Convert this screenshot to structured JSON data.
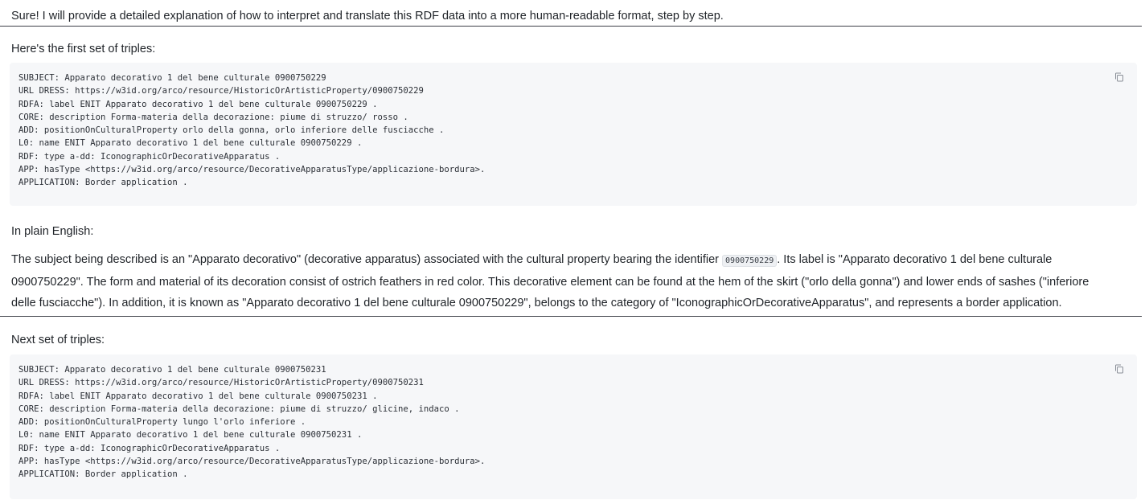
{
  "intro": "Sure! I will provide a detailed explanation of how to interpret and translate this RDF data into a more human-readable format, step by step.",
  "first_heading": "Here's the first set of triples:",
  "block1": {
    "lines": [
      "SUBJECT: Apparato decorativo 1 del bene culturale 0900750229",
      "URL DRESS: https://w3id.org/arco/resource/HistoricOrArtisticProperty/0900750229",
      "RDFA: label ENIT Apparato decorativo 1 del bene culturale 0900750229 .",
      "CORE: description Forma-materia della decorazione: piume di struzzo/ rosso .",
      "ADD: positionOnCulturalProperty orlo della gonna, orlo inferiore delle fusciacche .",
      "L0: name ENIT Apparato decorativo 1 del bene culturale 0900750229 .",
      "RDF: type a-dd: IconographicOrDecorativeApparatus .",
      "APP: hasType <https://w3id.org/arco/resource/DecorativeApparatusType/applicazione-bordura>.",
      "APPLICATION: Border application ."
    ]
  },
  "plain_heading": "In plain English:",
  "explanation": {
    "line1_a": "The subject being described is an \"Apparato decorativo\" (decorative apparatus) associated with the cultural property bearing the identifier ",
    "line1_code": "0900750229",
    "line1_b": ". Its label is \"Apparato decorativo 1 del bene culturale",
    "line2": "0900750229\". The form and material of its decoration consist of ostrich feathers in red color. This decorative element can be found at the hem of the skirt (\"orlo della gonna\") and lower ends of sashes (\"inferiore",
    "line3": "delle fusciacche\"). In addition, it is known as \"Apparato decorativo 1 del bene culturale 0900750229\", belongs to the category of \"IconographicOrDecorativeApparatus\", and represents a border application."
  },
  "next_heading": "Next set of triples:",
  "block2": {
    "lines": [
      "SUBJECT: Apparato decorativo 1 del bene culturale 0900750231",
      "URL DRESS: https://w3id.org/arco/resource/HistoricOrArtisticProperty/0900750231",
      "RDFA: label ENIT Apparato decorativo 1 del bene culturale 0900750231 .",
      "CORE: description Forma-materia della decorazione: piume di struzzo/ glicine, indaco .",
      "ADD: positionOnCulturalProperty lungo l'orlo inferiore .",
      "L0: name ENIT Apparato decorativo 1 del bene culturale 0900750231 .",
      "RDF: type a-dd: IconographicOrDecorativeApparatus .",
      "APP: hasType <https://w3id.org/arco/resource/DecorativeApparatusType/applicazione-bordura>.",
      "APPLICATION: Border application ."
    ]
  },
  "icons": {
    "copy": "copy-icon"
  }
}
